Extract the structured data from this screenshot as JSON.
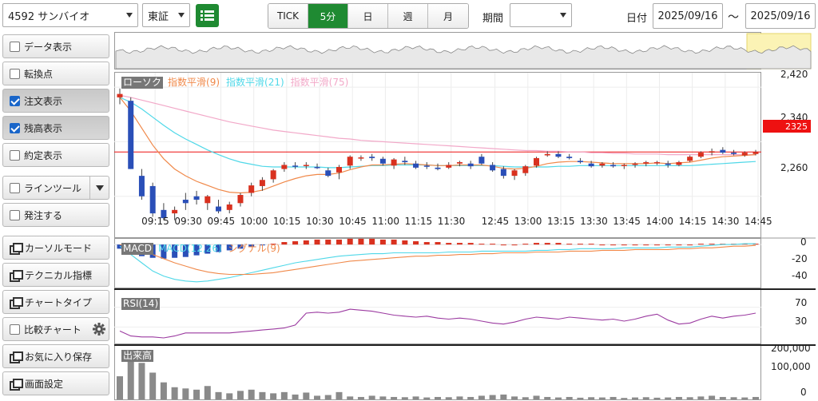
{
  "toolbar": {
    "symbol": "4592 サンバイオ",
    "market": "東証",
    "list_icon": "list-icon",
    "intervals": [
      "TICK",
      "5分",
      "日",
      "週",
      "月"
    ],
    "active_interval": "5分",
    "period_label": "期間",
    "period_value": "",
    "date_label": "日付",
    "date_from": "2025/09/16",
    "tilde": "～",
    "date_to": "2025/09/16"
  },
  "left_panel": {
    "data_display": "データ表示",
    "turning_point": "転換点",
    "order_display": "注文表示",
    "position_display": "残高表示",
    "execution_display": "約定表示",
    "line_tool": "ラインツール",
    "place_order": "発注する",
    "cursor_mode": "カーソルモード",
    "technical": "テクニカル指標",
    "chart_type": "チャートタイプ",
    "compare_chart": "比較チャート",
    "save_favorite": "お気に入り保存",
    "screen_settings": "画面設定"
  },
  "colors": {
    "accent_green": "#1f8a32",
    "up_candle": "#d9311f",
    "down_candle": "#2a4fb8",
    "ema9": "#f0894a",
    "ema21": "#4fd8e8",
    "ema75": "#f2a8c8",
    "rsi": "#9b3aa0",
    "price_line": "#ee1111"
  },
  "chart": {
    "legend": {
      "candle": "ローソク",
      "ema9": "指数平滑(9)",
      "ema21": "指数平滑(21)",
      "ema75": "指数平滑(75)"
    },
    "price_axis": [
      "2,420",
      "2,340",
      "2,260"
    ],
    "current_price": "2325",
    "time_labels": [
      "09:15",
      "09:30",
      "09:45",
      "10:00",
      "10:15",
      "10:30",
      "10:45",
      "11:00",
      "11:15",
      "11:30",
      "12:45",
      "13:00",
      "13:15",
      "13:30",
      "13:45",
      "14:00",
      "14:15",
      "14:30",
      "14:45"
    ],
    "macd": {
      "labels": [
        "MACD",
        "MACD(12,26)",
        "シグナル(9)"
      ],
      "axis": [
        "0",
        "-20",
        "-40"
      ]
    },
    "rsi": {
      "label": "RSI(14)",
      "axis": [
        "70",
        "30"
      ]
    },
    "volume": {
      "label": "出来高",
      "axis": [
        "200,000",
        "100,000",
        "0"
      ]
    }
  },
  "chart_data": {
    "type": "line",
    "candles": [
      [
        2405,
        2418,
        2395,
        2410
      ],
      [
        2400,
        2405,
        2300,
        2300
      ],
      [
        2290,
        2300,
        2255,
        2260
      ],
      [
        2275,
        2280,
        2230,
        2235
      ],
      [
        2240,
        2250,
        2225,
        2228
      ],
      [
        2235,
        2245,
        2225,
        2240
      ],
      [
        2255,
        2265,
        2240,
        2250
      ],
      [
        2260,
        2268,
        2248,
        2255
      ],
      [
        2250,
        2262,
        2240,
        2260
      ],
      [
        2245,
        2255,
        2235,
        2238
      ],
      [
        2240,
        2252,
        2235,
        2248
      ],
      [
        2250,
        2265,
        2245,
        2262
      ],
      [
        2265,
        2280,
        2260,
        2276
      ],
      [
        2275,
        2288,
        2268,
        2284
      ],
      [
        2285,
        2300,
        2280,
        2298
      ],
      [
        2300,
        2310,
        2296,
        2306
      ],
      [
        2305,
        2310,
        2300,
        2304
      ],
      [
        2305,
        2310,
        2300,
        2306
      ],
      [
        2303,
        2308,
        2300,
        2302
      ],
      [
        2298,
        2302,
        2288,
        2290
      ],
      [
        2295,
        2306,
        2285,
        2303
      ],
      [
        2305,
        2320,
        2300,
        2318
      ],
      [
        2316,
        2320,
        2312,
        2317
      ],
      [
        2318,
        2322,
        2312,
        2316
      ],
      [
        2315,
        2318,
        2305,
        2308
      ],
      [
        2305,
        2316,
        2300,
        2314
      ],
      [
        2312,
        2318,
        2306,
        2310
      ],
      [
        2308,
        2312,
        2300,
        2302
      ],
      [
        2305,
        2310,
        2300,
        2304
      ],
      [
        2302,
        2308,
        2298,
        2300
      ],
      [
        2302,
        2310,
        2300,
        2306
      ],
      [
        2308,
        2312,
        2304,
        2310
      ],
      [
        2308,
        2312,
        2300,
        2304
      ],
      [
        2318,
        2322,
        2306,
        2308
      ],
      [
        2306,
        2310,
        2296,
        2298
      ],
      [
        2300,
        2304,
        2286,
        2290
      ],
      [
        2290,
        2300,
        2284,
        2298
      ],
      [
        2294,
        2306,
        2290,
        2304
      ],
      [
        2305,
        2318,
        2302,
        2316
      ],
      [
        2320,
        2326,
        2318,
        2322
      ],
      [
        2322,
        2326,
        2316,
        2318
      ],
      [
        2318,
        2322,
        2314,
        2316
      ],
      [
        2312,
        2316,
        2308,
        2310
      ],
      [
        2308,
        2312,
        2302,
        2304
      ],
      [
        2305,
        2310,
        2302,
        2308
      ],
      [
        2306,
        2310,
        2302,
        2304
      ],
      [
        2305,
        2308,
        2300,
        2306
      ],
      [
        2306,
        2310,
        2302,
        2308
      ],
      [
        2308,
        2312,
        2304,
        2310
      ],
      [
        2310,
        2312,
        2306,
        2310
      ],
      [
        2308,
        2312,
        2302,
        2306
      ],
      [
        2306,
        2312,
        2304,
        2310
      ],
      [
        2312,
        2320,
        2310,
        2318
      ],
      [
        2318,
        2326,
        2316,
        2324
      ],
      [
        2324,
        2330,
        2320,
        2326
      ],
      [
        2328,
        2332,
        2322,
        2324
      ],
      [
        2324,
        2328,
        2320,
        2322
      ],
      [
        2320,
        2326,
        2318,
        2324
      ],
      [
        2322,
        2328,
        2320,
        2325
      ]
    ],
    "ema9": [
      2405,
      2385,
      2360,
      2335,
      2315,
      2300,
      2290,
      2282,
      2276,
      2270,
      2266,
      2265,
      2266,
      2269,
      2275,
      2281,
      2286,
      2290,
      2292,
      2292,
      2294,
      2299,
      2303,
      2306,
      2306,
      2307,
      2308,
      2307,
      2306,
      2305,
      2305,
      2306,
      2306,
      2306,
      2304,
      2301,
      2300,
      2301,
      2304,
      2308,
      2310,
      2311,
      2311,
      2310,
      2309,
      2308,
      2308,
      2308,
      2308,
      2309,
      2308,
      2309,
      2310,
      2313,
      2316,
      2318,
      2319,
      2320,
      2321
    ],
    "ema21": [
      2405,
      2398,
      2388,
      2376,
      2364,
      2353,
      2344,
      2336,
      2328,
      2321,
      2315,
      2310,
      2307,
      2304,
      2303,
      2303,
      2303,
      2303,
      2303,
      2302,
      2302,
      2303,
      2304,
      2305,
      2305,
      2306,
      2306,
      2306,
      2306,
      2305,
      2305,
      2305,
      2305,
      2305,
      2305,
      2304,
      2303,
      2303,
      2303,
      2303,
      2304,
      2304,
      2305,
      2305,
      2305,
      2305,
      2305,
      2305,
      2305,
      2305,
      2305,
      2305,
      2305,
      2306,
      2307,
      2308,
      2309,
      2310,
      2311
    ],
    "ema75": [
      2408,
      2405,
      2401,
      2397,
      2393,
      2389,
      2385,
      2381,
      2377,
      2373,
      2369,
      2366,
      2363,
      2360,
      2357,
      2355,
      2353,
      2351,
      2349,
      2347,
      2345,
      2344,
      2342,
      2341,
      2340,
      2339,
      2338,
      2337,
      2336,
      2335,
      2334,
      2333,
      2332,
      2331,
      2330,
      2329,
      2328,
      2327,
      2327,
      2326,
      2326,
      2325,
      2325,
      2324,
      2324,
      2323,
      2323,
      2322,
      2322,
      2322,
      2321,
      2321,
      2321,
      2321,
      2321,
      2321,
      2321,
      2321,
      2321
    ],
    "macd_hist": [
      -5,
      -10,
      -14,
      -16,
      -17,
      -16,
      -15,
      -13,
      -11,
      -9,
      -7,
      -5,
      -3,
      -1,
      1,
      3,
      4,
      5,
      6,
      6,
      6,
      7,
      7,
      7,
      6,
      6,
      5,
      4,
      3,
      3,
      2,
      2,
      2,
      1,
      1,
      0,
      0,
      1,
      2,
      2,
      2,
      1,
      1,
      1,
      0,
      0,
      0,
      0,
      0,
      0,
      0,
      0,
      0,
      1,
      1,
      1,
      1,
      1,
      1
    ],
    "macd": [
      -2,
      -12,
      -22,
      -32,
      -38,
      -42,
      -44,
      -45,
      -44,
      -42,
      -40,
      -37,
      -34,
      -31,
      -28,
      -25,
      -22,
      -20,
      -18,
      -16,
      -14,
      -13,
      -12,
      -11,
      -11,
      -10,
      -10,
      -10,
      -10,
      -10,
      -9,
      -9,
      -9,
      -8,
      -8,
      -8,
      -8,
      -8,
      -7,
      -7,
      -6,
      -6,
      -5,
      -5,
      -5,
      -5,
      -4,
      -4,
      -4,
      -4,
      -3,
      -3,
      -3,
      -2,
      -1,
      0,
      0,
      1,
      1
    ],
    "signal": [
      0,
      -3,
      -7,
      -12,
      -17,
      -22,
      -26,
      -30,
      -33,
      -35,
      -36,
      -36,
      -36,
      -35,
      -34,
      -32,
      -30,
      -28,
      -26,
      -24,
      -22,
      -20,
      -19,
      -18,
      -17,
      -16,
      -15,
      -14,
      -14,
      -13,
      -13,
      -12,
      -12,
      -11,
      -11,
      -10,
      -10,
      -10,
      -9,
      -9,
      -9,
      -8,
      -8,
      -8,
      -7,
      -7,
      -7,
      -6,
      -6,
      -6,
      -6,
      -5,
      -5,
      -4,
      -4,
      -3,
      -2,
      -2,
      -1
    ],
    "rsi": [
      22,
      12,
      10,
      10,
      8,
      12,
      18,
      18,
      18,
      18,
      18,
      20,
      22,
      24,
      26,
      28,
      34,
      58,
      60,
      58,
      60,
      66,
      64,
      62,
      58,
      54,
      52,
      50,
      52,
      48,
      46,
      48,
      46,
      42,
      38,
      36,
      40,
      46,
      50,
      48,
      46,
      50,
      48,
      46,
      44,
      46,
      42,
      46,
      52,
      56,
      44,
      36,
      38,
      46,
      52,
      48,
      52,
      54,
      58
    ],
    "volume": [
      95000,
      200000,
      150000,
      110000,
      70000,
      50000,
      45000,
      40000,
      55000,
      30000,
      25000,
      35000,
      40000,
      30000,
      25000,
      30000,
      20000,
      28000,
      15000,
      18000,
      30000,
      12000,
      10000,
      15000,
      12000,
      10000,
      9000,
      12000,
      8000,
      10000,
      9000,
      12000,
      10000,
      15000,
      18000,
      20000,
      12000,
      9000,
      15000,
      10000,
      8000,
      10000,
      7000,
      9000,
      8000,
      10000,
      6000,
      8000,
      9000,
      7000,
      8000,
      10000,
      9000,
      12000,
      15000,
      10000,
      9000,
      8000,
      10000
    ]
  }
}
